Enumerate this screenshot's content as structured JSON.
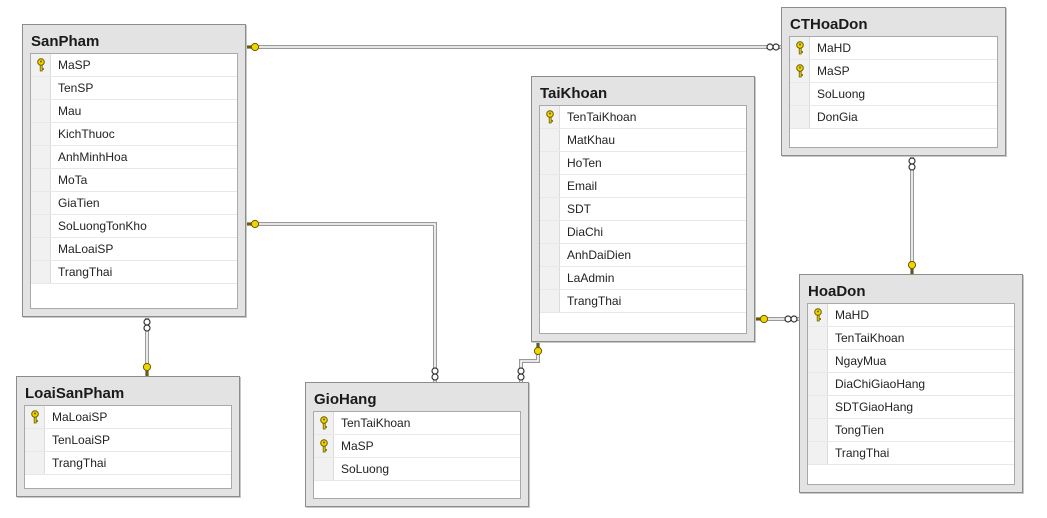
{
  "colors": {
    "background": "#ffffff",
    "table_frame": "#e3e3e3",
    "relationship_line": "#7a7a7a",
    "key_icon": "#f0d400",
    "key_outline": "#6b5b00"
  },
  "tables": [
    {
      "id": "SanPham",
      "title": "SanPham",
      "columns": [
        {
          "name": "MaSP",
          "pk": true
        },
        {
          "name": "TenSP",
          "pk": false
        },
        {
          "name": "Mau",
          "pk": false
        },
        {
          "name": "KichThuoc",
          "pk": false
        },
        {
          "name": "AnhMinhHoa",
          "pk": false
        },
        {
          "name": "MoTa",
          "pk": false
        },
        {
          "name": "GiaTien",
          "pk": false
        },
        {
          "name": "SoLuongTonKho",
          "pk": false
        },
        {
          "name": "MaLoaiSP",
          "pk": false
        },
        {
          "name": "TrangThai",
          "pk": false
        }
      ]
    },
    {
      "id": "LoaiSanPham",
      "title": "LoaiSanPham",
      "columns": [
        {
          "name": "MaLoaiSP",
          "pk": true
        },
        {
          "name": "TenLoaiSP",
          "pk": false
        },
        {
          "name": "TrangThai",
          "pk": false
        }
      ]
    },
    {
      "id": "GioHang",
      "title": "GioHang",
      "columns": [
        {
          "name": "TenTaiKhoan",
          "pk": true
        },
        {
          "name": "MaSP",
          "pk": true
        },
        {
          "name": "SoLuong",
          "pk": false
        }
      ]
    },
    {
      "id": "TaiKhoan",
      "title": "TaiKhoan",
      "columns": [
        {
          "name": "TenTaiKhoan",
          "pk": true
        },
        {
          "name": "MatKhau",
          "pk": false
        },
        {
          "name": "HoTen",
          "pk": false
        },
        {
          "name": "Email",
          "pk": false
        },
        {
          "name": "SDT",
          "pk": false
        },
        {
          "name": "DiaChi",
          "pk": false
        },
        {
          "name": "AnhDaiDien",
          "pk": false
        },
        {
          "name": "LaAdmin",
          "pk": false
        },
        {
          "name": "TrangThai",
          "pk": false
        }
      ]
    },
    {
      "id": "CTHoaDon",
      "title": "CTHoaDon",
      "columns": [
        {
          "name": "MaHD",
          "pk": true
        },
        {
          "name": "MaSP",
          "pk": true
        },
        {
          "name": "SoLuong",
          "pk": false
        },
        {
          "name": "DonGia",
          "pk": false
        }
      ]
    },
    {
      "id": "HoaDon",
      "title": "HoaDon",
      "columns": [
        {
          "name": "MaHD",
          "pk": true
        },
        {
          "name": "TenTaiKhoan",
          "pk": false
        },
        {
          "name": "NgayMua",
          "pk": false
        },
        {
          "name": "DiaChiGiaoHang",
          "pk": false
        },
        {
          "name": "SDTGiaoHang",
          "pk": false
        },
        {
          "name": "TongTien",
          "pk": false
        },
        {
          "name": "TrangThai",
          "pk": false
        }
      ]
    }
  ],
  "relationships": [
    {
      "from": "SanPham",
      "to": "CTHoaDon"
    },
    {
      "from": "SanPham",
      "to": "GioHang"
    },
    {
      "from": "LoaiSanPham",
      "to": "SanPham"
    },
    {
      "from": "TaiKhoan",
      "to": "GioHang"
    },
    {
      "from": "TaiKhoan",
      "to": "HoaDon"
    },
    {
      "from": "HoaDon",
      "to": "CTHoaDon"
    }
  ]
}
